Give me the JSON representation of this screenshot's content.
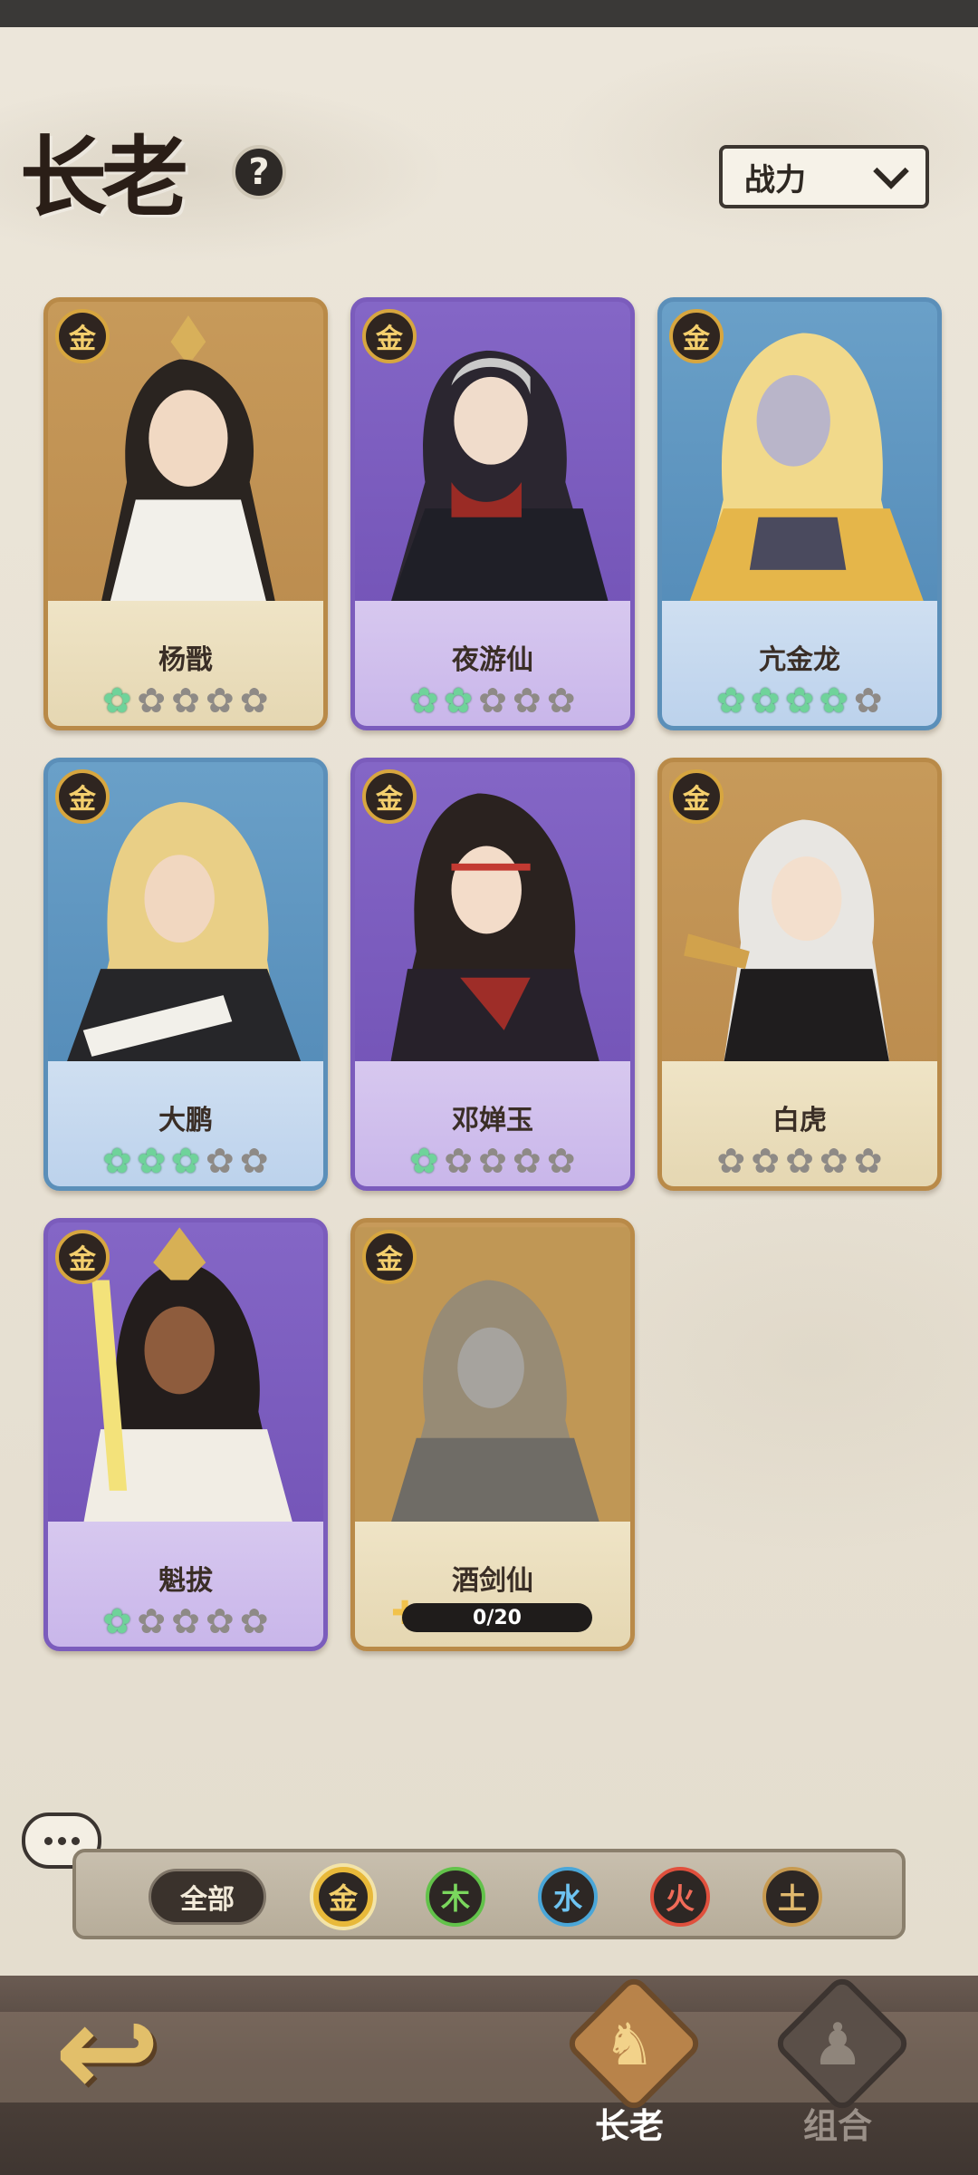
{
  "header": {
    "title": "长老",
    "help": "?",
    "sort_label": "战力"
  },
  "cards": [
    {
      "name": "杨戬",
      "element": "金",
      "stars_on": 1,
      "stars_total": 5,
      "color": "#b98a48"
    },
    {
      "name": "夜游仙",
      "element": "金",
      "stars_on": 2,
      "stars_total": 5,
      "color": "#7b5cbc"
    },
    {
      "name": "亢金龙",
      "element": "金",
      "stars_on": 4,
      "stars_total": 5,
      "color": "#5b8fb9"
    },
    {
      "name": "大鹏",
      "element": "金",
      "stars_on": 3,
      "stars_total": 5,
      "color": "#5b8fb9"
    },
    {
      "name": "邓婵玉",
      "element": "金",
      "stars_on": 1,
      "stars_total": 5,
      "color": "#7b5cbc"
    },
    {
      "name": "白虎",
      "element": "金",
      "stars_on": 0,
      "stars_total": 5,
      "color": "#b98a48"
    },
    {
      "name": "魁拔",
      "element": "金",
      "stars_on": 1,
      "stars_total": 5,
      "color": "#7b5cbc"
    },
    {
      "name": "酒剑仙",
      "element": "金",
      "fragments": "0/20",
      "color": "#b98a48"
    }
  ],
  "filter": {
    "all_label": "全部",
    "elements": [
      {
        "label": "金",
        "color": "#e8b93a",
        "selected": true
      },
      {
        "label": "木",
        "color": "#62c24a"
      },
      {
        "label": "水",
        "color": "#4aa6d8"
      },
      {
        "label": "火",
        "color": "#e0503d"
      },
      {
        "label": "土",
        "color": "#c79a50"
      }
    ]
  },
  "nav": {
    "tabs": [
      {
        "label": "长老",
        "active": true
      },
      {
        "label": "组合",
        "active": false
      }
    ]
  }
}
